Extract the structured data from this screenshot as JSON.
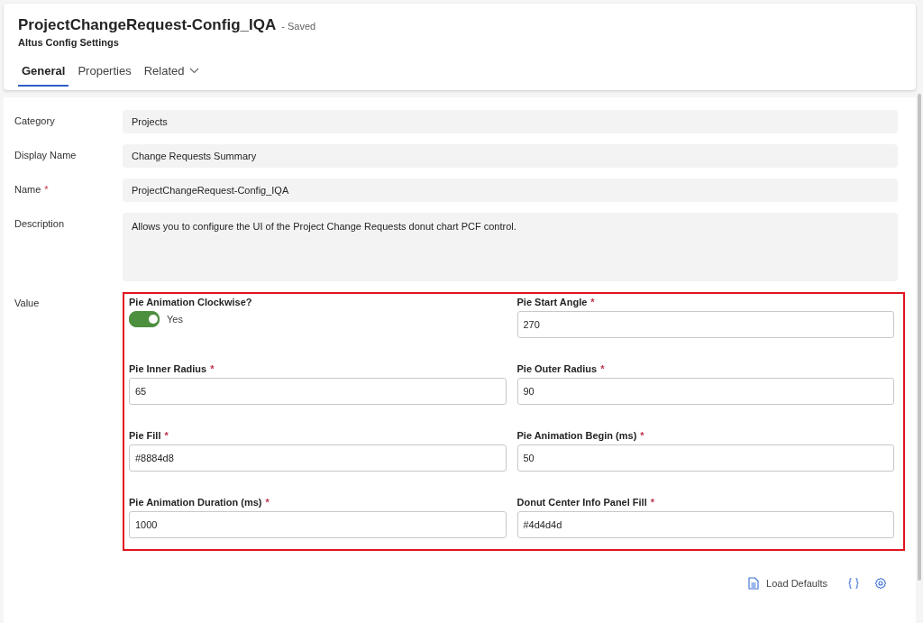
{
  "header": {
    "title": "ProjectChangeRequest-Config_IQA",
    "status": "- Saved",
    "subtitle": "Altus Config Settings"
  },
  "tabs": [
    {
      "label": "General",
      "selected": true,
      "dropdown": false
    },
    {
      "label": "Properties",
      "selected": false,
      "dropdown": false
    },
    {
      "label": "Related",
      "selected": false,
      "dropdown": true
    }
  ],
  "fields": [
    {
      "label": "Category",
      "value": "Projects",
      "kind": "text"
    },
    {
      "label": "Display Name",
      "value": "Change Requests Summary",
      "kind": "text"
    },
    {
      "label": "Name",
      "required_mark": "*",
      "value": "ProjectChangeRequest-Config_IQA",
      "kind": "text"
    },
    {
      "label": "Description",
      "value": "Allows you to configure the UI of the Project Change Requests donut chart PCF control.",
      "kind": "multiline"
    }
  ],
  "value_section": {
    "label": "Value",
    "settings": [
      {
        "label": "Pie Animation Clockwise?",
        "kind": "toggle",
        "on": true,
        "value": "Yes"
      },
      {
        "label": "Pie Start Angle",
        "required_mark": "*",
        "kind": "input",
        "value": "270"
      },
      {
        "label": "Pie Inner Radius",
        "required_mark": "*",
        "kind": "input",
        "value": "65"
      },
      {
        "label": "Pie Outer Radius",
        "required_mark": "*",
        "kind": "input",
        "value": "90"
      },
      {
        "label": "Pie Fill",
        "required_mark": "*",
        "kind": "input",
        "value": "#8884d8"
      },
      {
        "label": "Pie Animation Begin (ms)",
        "required_mark": "*",
        "kind": "input",
        "value": "50"
      },
      {
        "label": "Pie Animation Duration (ms)",
        "required_mark": "*",
        "kind": "input",
        "value": "1000"
      },
      {
        "label": "Donut Center Info Panel Fill",
        "required_mark": "*",
        "kind": "input",
        "value": "#4d4d4d"
      }
    ]
  },
  "footer": {
    "load_defaults": "Load Defaults"
  }
}
